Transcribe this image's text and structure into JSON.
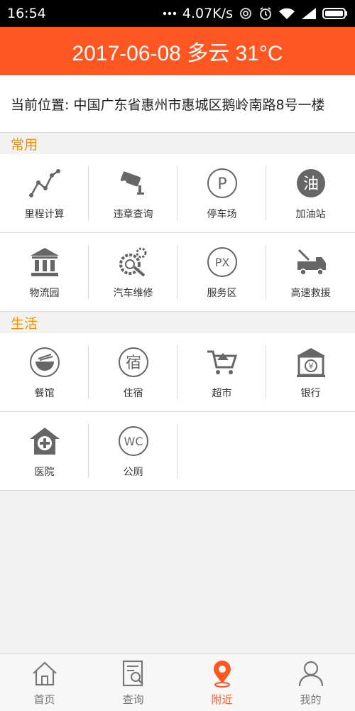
{
  "status_bar": {
    "time": "16:54",
    "speed": "4.07K/s",
    "icons": [
      "more-icon",
      "sync-icon",
      "alarm-icon",
      "wifi-icon",
      "signal-icon",
      "battery-icon"
    ]
  },
  "header": {
    "title": "2017-06-08 多云 31°C"
  },
  "location": {
    "text": "当前位置: 中国广东省惠州市惠城区鹅岭南路8号一楼"
  },
  "sections": {
    "common": {
      "label": "常用",
      "items": [
        {
          "label": "里程计算",
          "icon": "mileage-chart-icon"
        },
        {
          "label": "违章查询",
          "icon": "traffic-camera-icon"
        },
        {
          "label": "停车场",
          "icon": "parking-icon"
        },
        {
          "label": "加油站",
          "icon": "gas-station-icon"
        },
        {
          "label": "物流园",
          "icon": "logistics-building-icon"
        },
        {
          "label": "汽车维修",
          "icon": "car-repair-icon"
        },
        {
          "label": "服务区",
          "icon": "service-area-icon"
        },
        {
          "label": "高速救援",
          "icon": "tow-truck-icon"
        }
      ]
    },
    "life": {
      "label": "生活",
      "items": [
        {
          "label": "餐馆",
          "icon": "restaurant-bowl-icon"
        },
        {
          "label": "住宿",
          "icon": "lodging-icon"
        },
        {
          "label": "超市",
          "icon": "shopping-cart-icon"
        },
        {
          "label": "银行",
          "icon": "bank-icon"
        },
        {
          "label": "医院",
          "icon": "hospital-icon"
        },
        {
          "label": "公厕",
          "icon": "toilet-wc-icon"
        }
      ]
    }
  },
  "icon_text": {
    "parking": "P",
    "gas": "油",
    "service": "PX",
    "lodging": "宿",
    "toilet": "WC"
  },
  "bottom_nav": {
    "tabs": [
      {
        "label": "首页",
        "icon": "home-icon"
      },
      {
        "label": "查询",
        "icon": "search-document-icon"
      },
      {
        "label": "附近",
        "icon": "location-pin-icon"
      },
      {
        "label": "我的",
        "icon": "user-icon"
      }
    ],
    "active": "附近"
  },
  "colors": {
    "accent": "#ff5722",
    "section_label": "#f29100",
    "icon_gray": "#6b6b6b"
  }
}
